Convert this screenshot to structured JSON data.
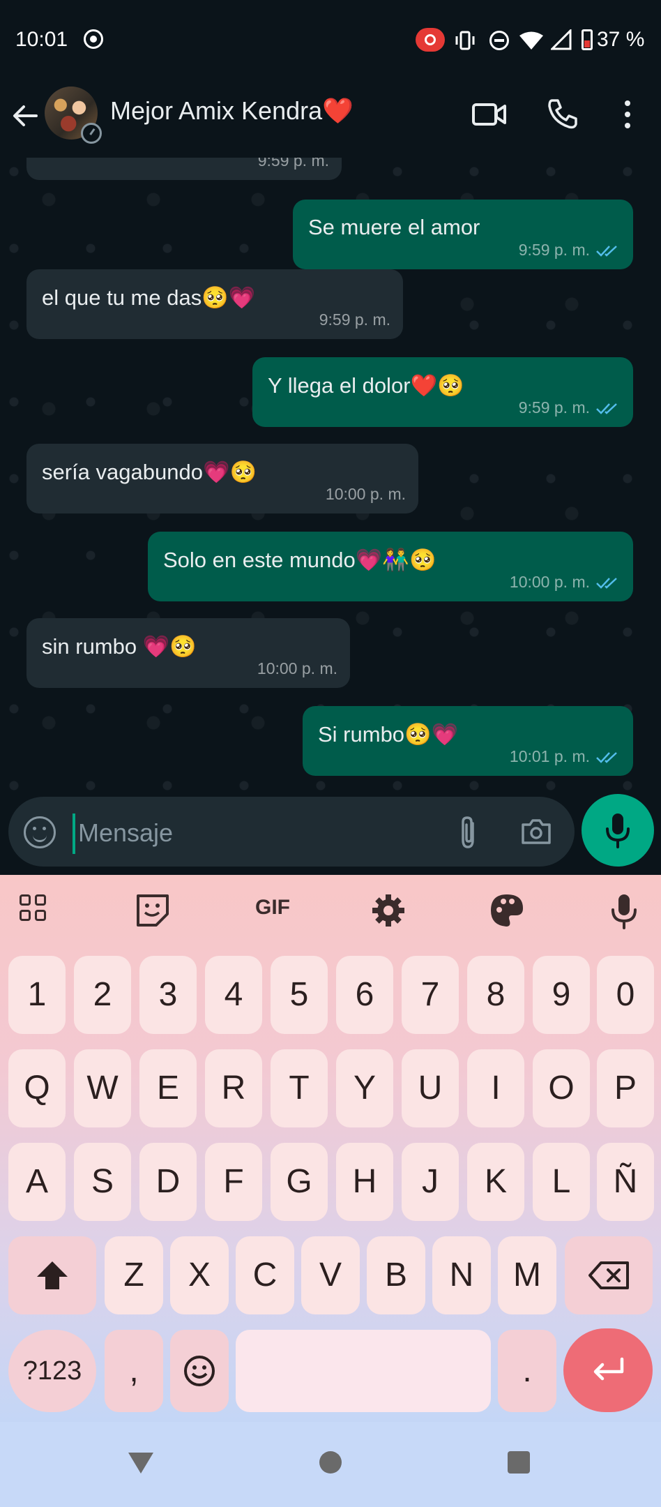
{
  "status_bar": {
    "time": "10:01",
    "battery": "37 %"
  },
  "header": {
    "contact_name": "Mejor Amix Kendra❤️"
  },
  "messages": [
    {
      "direction": "in",
      "text": "",
      "time": "9:59 p. m."
    },
    {
      "direction": "out",
      "text": "Se muere el amor",
      "time": "9:59 p. m.",
      "read": true
    },
    {
      "direction": "in",
      "text": "el que tu me das🥺💗",
      "time": "9:59 p. m."
    },
    {
      "direction": "out",
      "text": "Y llega el dolor❤️🥺",
      "time": "9:59 p. m.",
      "read": true
    },
    {
      "direction": "in",
      "text": "sería vagabundo💗🥺",
      "time": "10:00 p. m."
    },
    {
      "direction": "out",
      "text": "Solo en este mundo💗👫🥺",
      "time": "10:00 p. m.",
      "read": true
    },
    {
      "direction": "in",
      "text": "sin rumbo 💗🥺",
      "time": "10:00 p. m."
    },
    {
      "direction": "out",
      "text": "Si rumbo🥺💗",
      "time": "10:01 p. m.",
      "read": true
    }
  ],
  "composer": {
    "placeholder": "Mensaje"
  },
  "keyboard": {
    "toolbar": {
      "gif_label": "GIF"
    },
    "row_numbers": [
      "1",
      "2",
      "3",
      "4",
      "5",
      "6",
      "7",
      "8",
      "9",
      "0"
    ],
    "row_1": [
      "Q",
      "W",
      "E",
      "R",
      "T",
      "Y",
      "U",
      "I",
      "O",
      "P"
    ],
    "row_2": [
      "A",
      "S",
      "D",
      "F",
      "G",
      "H",
      "J",
      "K",
      "L",
      "Ñ"
    ],
    "row_3": [
      "Z",
      "X",
      "C",
      "V",
      "B",
      "N",
      "M"
    ],
    "symbols_label": "?123",
    "comma_label": ",",
    "period_label": "."
  },
  "colors": {
    "incoming_bubble": "#202c33",
    "outgoing_bubble": "#005c4b",
    "accent_green": "#00a884",
    "read_ticks": "#53bdeb",
    "enter_key": "#ee6c76"
  },
  "icons": {
    "status": [
      "sync-icon",
      "screen-record-icon",
      "vibrate-icon",
      "dnd-icon",
      "wifi-icon",
      "signal-icon",
      "battery-icon"
    ],
    "header": [
      "back-arrow-icon",
      "video-call-icon",
      "phone-icon",
      "more-options-icon"
    ],
    "composer": [
      "sticker-icon",
      "attach-icon",
      "camera-icon",
      "mic-icon"
    ],
    "keyboard": [
      "grid-icon",
      "sticker-icon",
      "gif-icon",
      "settings-icon",
      "palette-icon",
      "voice-icon",
      "shift-icon",
      "backspace-icon",
      "emoji-icon",
      "enter-icon"
    ],
    "nav": [
      "back-icon",
      "home-icon",
      "recents-icon"
    ]
  }
}
